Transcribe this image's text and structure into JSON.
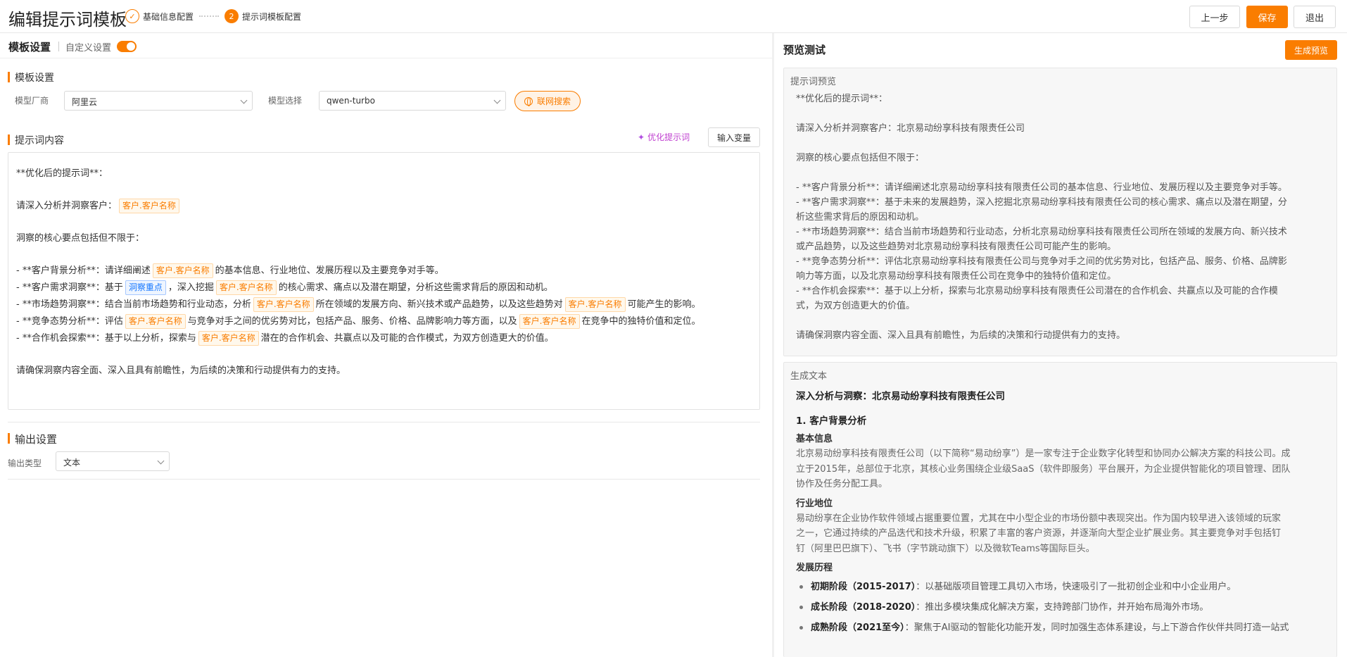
{
  "header": {
    "title": "编辑提示词模板",
    "steps": [
      {
        "label": "基础信息配置",
        "state": "done"
      },
      {
        "label": "提示词模板配置",
        "number": "2",
        "state": "active"
      }
    ],
    "prev_label": "上一步",
    "save_label": "保存",
    "exit_label": "退出"
  },
  "left": {
    "title": "模板设置",
    "custom_label": "自定义设置",
    "custom_enabled": true,
    "template_section": "模板设置",
    "vendor_label": "模型厂商",
    "vendor_value": "阿里云",
    "model_label": "模型选择",
    "model_value": "qwen-turbo",
    "web_search_label": "联网搜索",
    "prompt_section": "提示词内容",
    "optimize_label": "优化提示词",
    "input_var_label": "输入变量",
    "editor": {
      "l1": "**优化后的提示词**：",
      "l2_pre": "请深入分析并洞察客户：",
      "var_customer": "客户.客户名称",
      "var_focus": "洞察重点",
      "l3": "洞察的核心要点包括但不限于：",
      "b1_a": "- **客户背景分析**：请详细阐述",
      "b1_b": "的基本信息、行业地位、发展历程以及主要竞争对手等。",
      "b2_a": "- **客户需求洞察**：基于",
      "b2_b": "，深入挖掘",
      "b2_c": "的核心需求、痛点以及潜在期望，分析这些需求背后的原因和动机。",
      "b3_a": "- **市场趋势洞察**：结合当前市场趋势和行业动态，分析",
      "b3_b": "所在领域的发展方向、新兴技术或产品趋势，以及这些趋势对",
      "b3_c": "可能产生的影响。",
      "b4_a": "- **竞争态势分析**：评估",
      "b4_b": "与竞争对手之间的优劣势对比，包括产品、服务、价格、品牌影响力等方面，以及",
      "b4_c": "在竞争中的独特价值和定位。",
      "b5_a": "- **合作机会探索**：基于以上分析，探索与",
      "b5_b": "潜在的合作机会、共赢点以及可能的合作模式，为双方创造更大的价值。",
      "l_end": "请确保洞察内容全面、深入且具有前瞻性，为后续的决策和行动提供有力的支持。"
    },
    "output_section": "输出设置",
    "output_type_label": "输出类型",
    "output_type_value": "文本"
  },
  "right": {
    "title": "预览测试",
    "generate_label": "生成预览",
    "preview_title": "提示词预览",
    "preview": {
      "p1": "**优化后的提示词**：",
      "p2": "请深入分析并洞察客户：北京易动纷享科技有限责任公司",
      "p3": "洞察的核心要点包括但不限于：",
      "b1": "- **客户背景分析**：请详细阐述北京易动纷享科技有限责任公司的基本信息、行业地位、发展历程以及主要竞争对手等。",
      "b2a": "- **客户需求洞察**：基于未来的发展趋势，深入挖掘北京易动纷享科技有限责任公司的核心需求、痛点以及潜在期望，分",
      "b2b": "析这些需求背后的原因和动机。",
      "b3a": "- **市场趋势洞察**：结合当前市场趋势和行业动态，分析北京易动纷享科技有限责任公司所在领域的发展方向、新兴技术",
      "b3b": "或产品趋势，以及这些趋势对北京易动纷享科技有限责任公司可能产生的影响。",
      "b4a": "- **竞争态势分析**：评估北京易动纷享科技有限责任公司与竞争对手之间的优劣势对比，包括产品、服务、价格、品牌影",
      "b4b": "响力等方面，以及北京易动纷享科技有限责任公司在竞争中的独特价值和定位。",
      "b5a": "- **合作机会探索**：基于以上分析，探索与北京易动纷享科技有限责任公司潜在的合作机会、共赢点以及可能的合作模",
      "b5b": "式，为双方创造更大的价值。",
      "p_end": "请确保洞察内容全面、深入且具有前瞻性，为后续的决策和行动提供有力的支持。"
    },
    "gen_title": "生成文本",
    "gen": {
      "h1": "深入分析与洞察：北京易动纷享科技有限责任公司",
      "h2": "1. 客户背景分析",
      "s1": "基本信息",
      "s1_l1": "北京易动纷享科技有限责任公司（以下简称“易动纷享”）是一家专注于企业数字化转型和协同办公解决方案的科技公司。成",
      "s1_l2": "立于2015年，总部位于北京，其核心业务围绕企业级SaaS（软件即服务）平台展开，为企业提供智能化的项目管理、团队",
      "s1_l3": "协作及任务分配工具。",
      "s2": "行业地位",
      "s2_l1": "易动纷享在企业协作软件领域占据重要位置，尤其在中小型企业的市场份额中表现突出。作为国内较早进入该领域的玩家",
      "s2_l2": "之一，它通过持续的产品迭代和技术升级，积累了丰富的客户资源，并逐渐向大型企业扩展业务。其主要竞争对手包括钉",
      "s2_l3": "钉（阿里巴巴旗下）、飞书（字节跳动旗下）以及微软Teams等国际巨头。",
      "s3": "发展历程",
      "li1_b": "初期阶段（2015-2017）",
      "li1_t": "：以基础版项目管理工具切入市场，快速吸引了一批初创企业和中小企业用户。",
      "li2_b": "成长阶段（2018-2020）",
      "li2_t": "：推出多模块集成化解决方案，支持跨部门协作，并开始布局海外市场。",
      "li3_b": "成熟阶段（2021至今）",
      "li3_t": "：聚焦于AI驱动的智能化功能开发，同时加强生态体系建设，与上下游合作伙伴共同打造一站式"
    }
  }
}
